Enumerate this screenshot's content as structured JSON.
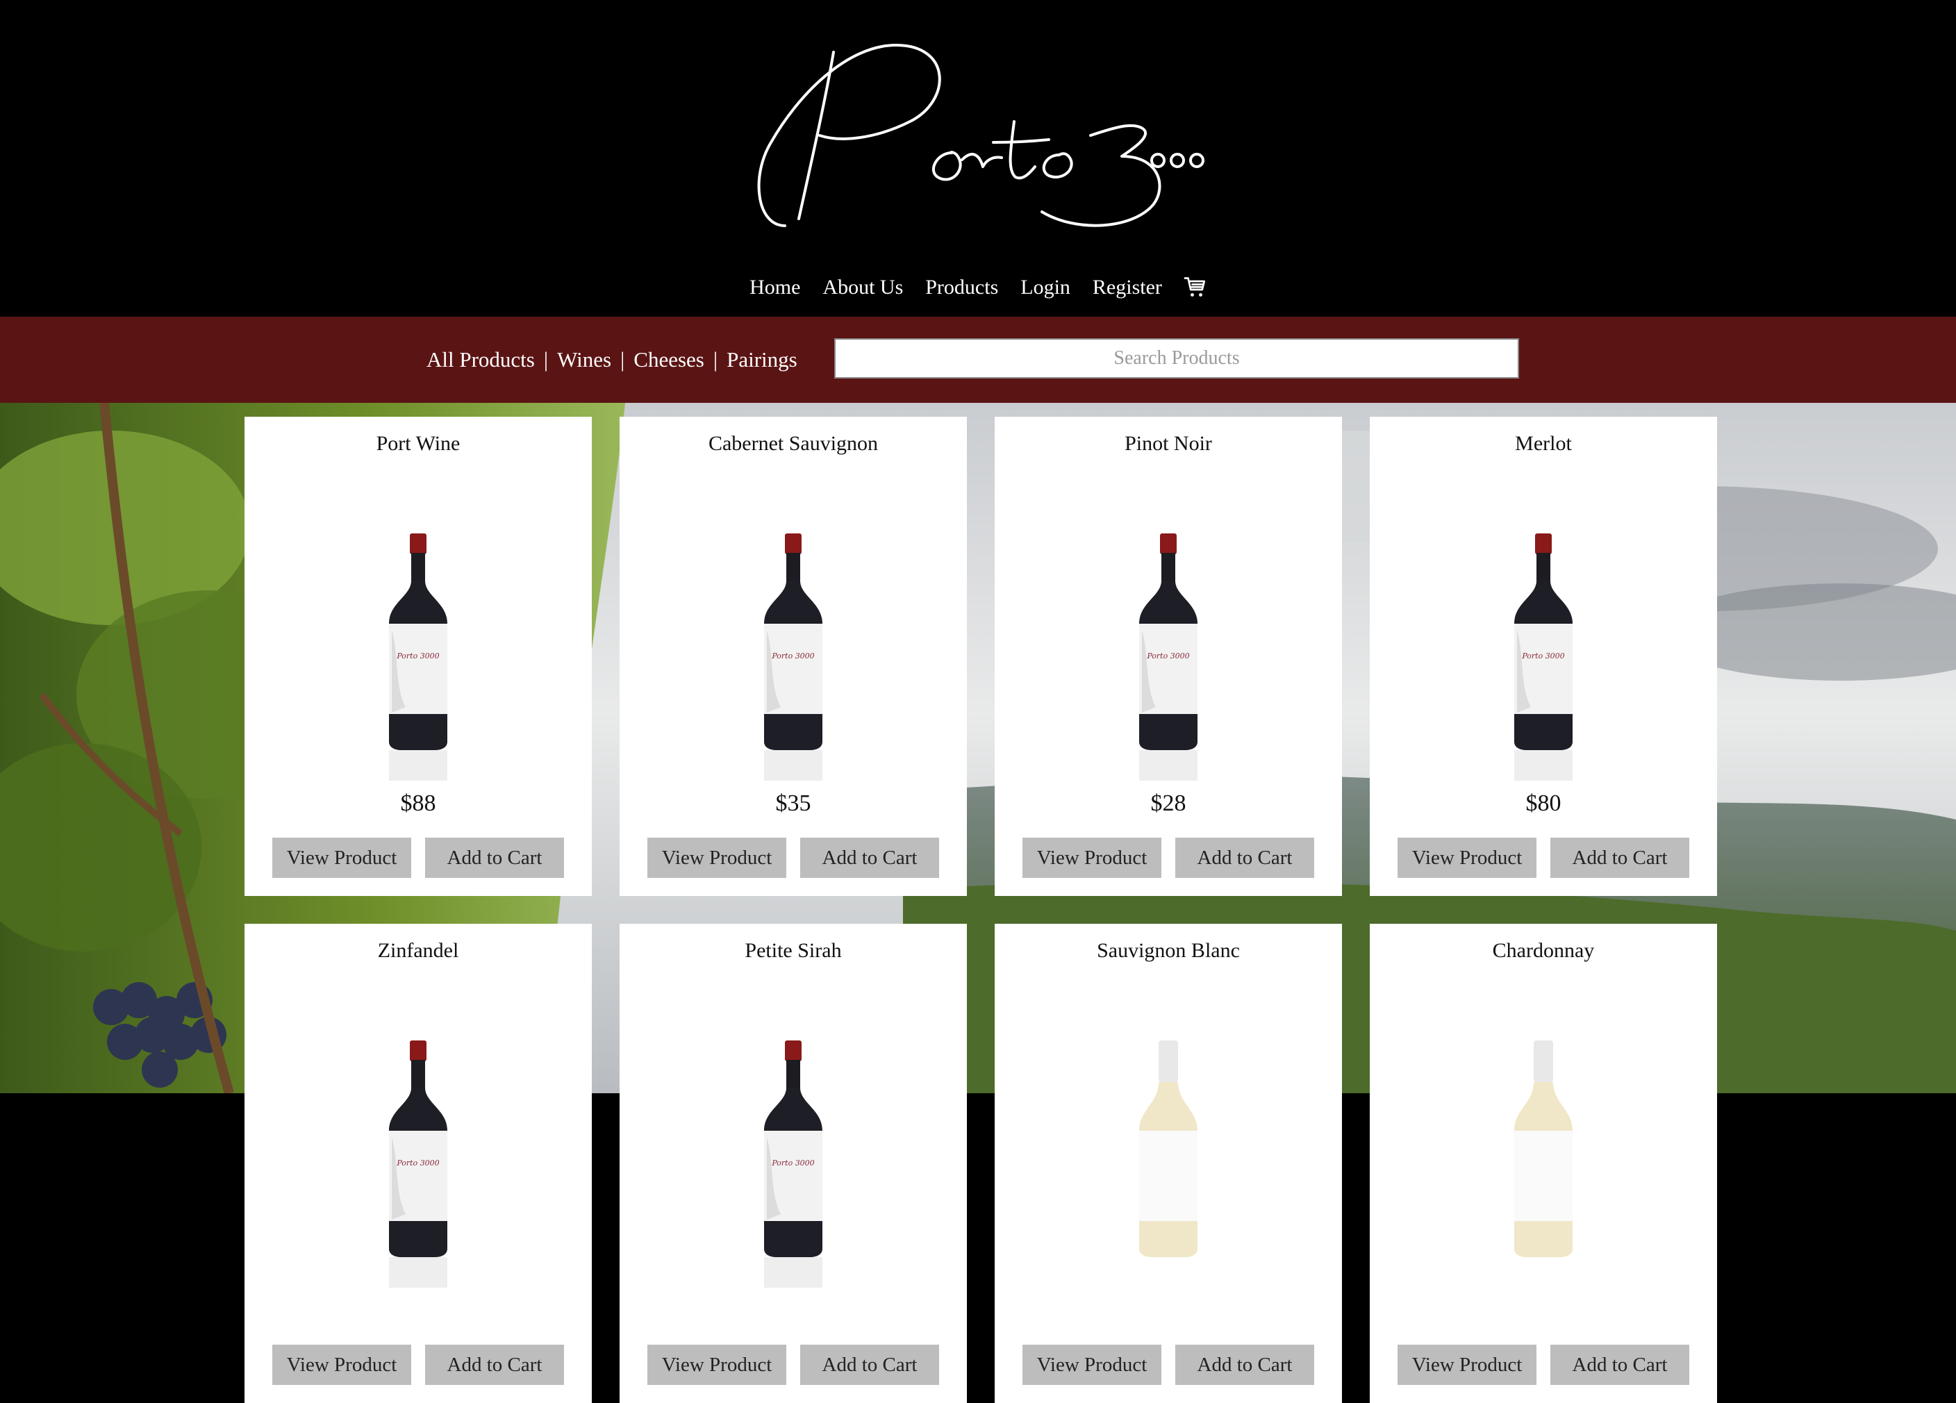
{
  "brand": {
    "logo_text": "Porto 3000"
  },
  "nav": {
    "items": [
      "Home",
      "About Us",
      "Products",
      "Login",
      "Register"
    ],
    "cart_icon": "cart-icon"
  },
  "filters": {
    "categories": [
      "All Products",
      "Wines",
      "Cheeses",
      "Pairings"
    ],
    "separator": "|"
  },
  "search": {
    "placeholder": "Search Products",
    "value": ""
  },
  "products": [
    {
      "name": "Port Wine",
      "price": "$88",
      "bottle": "red",
      "view_label": "View Product",
      "cart_label": "Add to Cart"
    },
    {
      "name": "Cabernet Sauvignon",
      "price": "$35",
      "bottle": "red",
      "view_label": "View Product",
      "cart_label": "Add to Cart"
    },
    {
      "name": "Pinot Noir",
      "price": "$28",
      "bottle": "red",
      "view_label": "View Product",
      "cart_label": "Add to Cart"
    },
    {
      "name": "Merlot",
      "price": "$80",
      "bottle": "red",
      "view_label": "View Product",
      "cart_label": "Add to Cart"
    },
    {
      "name": "Zinfandel",
      "price": "",
      "bottle": "red",
      "view_label": "View Product",
      "cart_label": "Add to Cart"
    },
    {
      "name": "Petite Sirah",
      "price": "",
      "bottle": "red",
      "view_label": "View Product",
      "cart_label": "Add to Cart"
    },
    {
      "name": "Sauvignon Blanc",
      "price": "",
      "bottle": "white",
      "view_label": "View Product",
      "cart_label": "Add to Cart"
    },
    {
      "name": "Chardonnay",
      "price": "",
      "bottle": "white",
      "view_label": "View Product",
      "cart_label": "Add to Cart"
    }
  ],
  "colors": {
    "header": "#000000",
    "filterbar": "#5b1414",
    "button": "#bdbdbd"
  }
}
